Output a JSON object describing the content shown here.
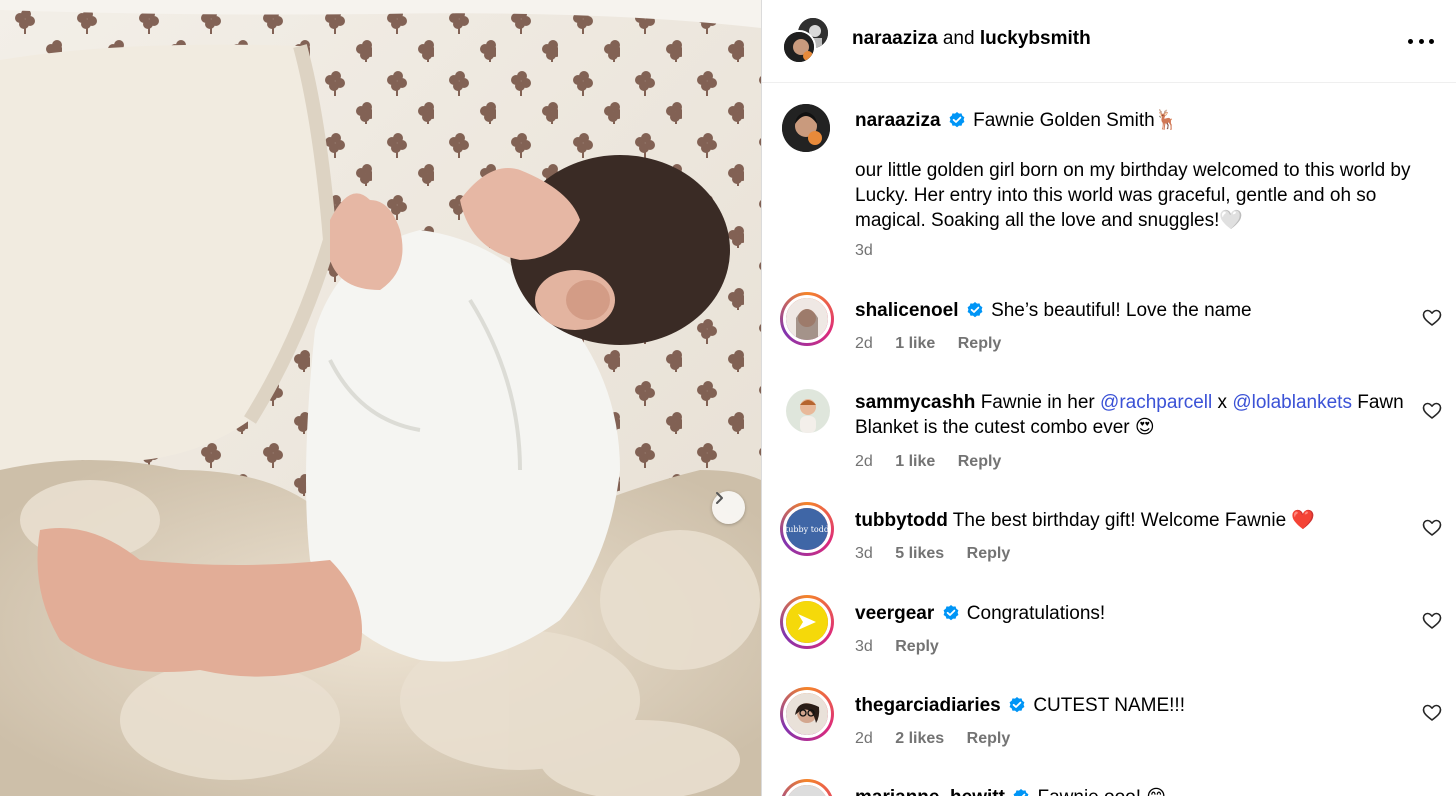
{
  "post": {
    "authors": {
      "primary": "naraaziza",
      "joiner": "and",
      "secondary": "luckybsmith"
    },
    "caption": {
      "username": "naraaziza",
      "title_line": "Fawnie Golden Smith🦌",
      "body": "our little golden girl born on my birthday welcomed to this world by Lucky. Her entry into this world was graceful, gentle and oh so magical. Soaking all the love and snuggles!🤍",
      "time": "3d"
    }
  },
  "comments": [
    {
      "username": "shalicenoel",
      "verified": true,
      "text": "She’s beautiful! Love the name",
      "time": "2d",
      "likes": "1 like",
      "reply": "Reply"
    },
    {
      "username": "sammycashh",
      "verified": false,
      "text_before": "Fawnie in her ",
      "mention1": "@rachparcell",
      "text_mid": " x ",
      "mention2": "@lolablankets",
      "text_after": " Fawn Blanket is the cutest combo ever 😍",
      "time": "2d",
      "likes": "1 like",
      "reply": "Reply"
    },
    {
      "username": "tubbytodd",
      "verified": false,
      "text": "The best birthday gift! Welcome Fawnie ❤️",
      "time": "3d",
      "likes": "5 likes",
      "reply": "Reply"
    },
    {
      "username": "veergear",
      "verified": true,
      "text": "Congratulations!",
      "time": "3d",
      "reply": "Reply"
    },
    {
      "username": "thegarciadiaries",
      "verified": true,
      "text": "CUTEST NAME!!!",
      "time": "2d",
      "likes": "2 likes",
      "reply": "Reply"
    },
    {
      "username": "marianne_hewitt",
      "verified": true,
      "text": "Fawnie ooo! 😊"
    }
  ],
  "icons": {
    "more": "more-horizontal-icon",
    "heart": "heart-outline-icon",
    "verified": "verified-badge-icon",
    "next": "chevron-right-icon"
  },
  "colors": {
    "verified": "#0095f6",
    "mention": "#3b52d6",
    "meta": "#737373"
  }
}
